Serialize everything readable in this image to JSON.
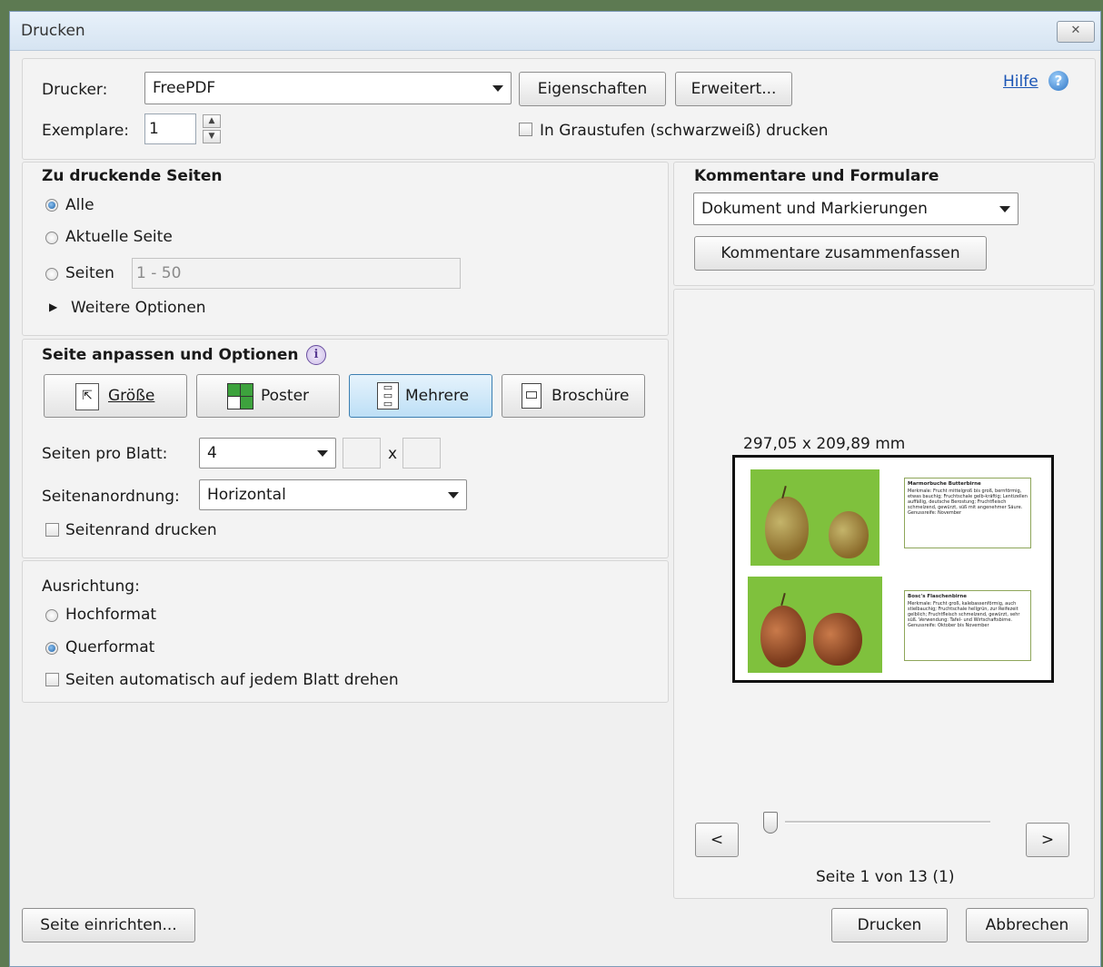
{
  "window": {
    "title": "Drucken",
    "close_label": "✕"
  },
  "header": {
    "printer_label": "Drucker:",
    "printer_value": "FreePDF",
    "properties_button": "Eigenschaften",
    "advanced_button": "Erweitert...",
    "help_link": "Hilfe",
    "copies_label": "Exemplare:",
    "copies_value": "1",
    "grayscale_label": "In Graustufen (schwarzweiß) drucken",
    "grayscale_checked": false
  },
  "pages": {
    "title": "Zu druckende Seiten",
    "all_label": "Alle",
    "current_label": "Aktuelle Seite",
    "pages_label": "Seiten",
    "pages_range": "1 - 50",
    "more_options": "Weitere Optionen",
    "selected": "Alle"
  },
  "sizing": {
    "title": "Seite anpassen und Optionen",
    "tabs": [
      {
        "label": "Größe",
        "active": false
      },
      {
        "label": "Poster",
        "active": false
      },
      {
        "label": "Mehrere",
        "active": true
      },
      {
        "label": "Broschüre",
        "active": false
      }
    ],
    "pages_per_sheet_label": "Seiten pro Blatt:",
    "pages_per_sheet_value": "4",
    "x_label": "x",
    "order_label": "Seitenanordnung:",
    "order_value": "Horizontal",
    "border_label": "Seitenrand drucken",
    "border_checked": false
  },
  "orientation": {
    "title": "Ausrichtung:",
    "portrait_label": "Hochformat",
    "landscape_label": "Querformat",
    "selected": "Querformat",
    "auto_rotate_label": "Seiten automatisch auf jedem Blatt drehen",
    "auto_rotate_checked": false
  },
  "comments": {
    "title": "Kommentare und Formulare",
    "select_value": "Dokument und Markierungen",
    "summarize_button": "Kommentare zusammenfassen"
  },
  "preview": {
    "dimensions": "297,05 x 209,89 mm",
    "prev_button": "<",
    "next_button": ">",
    "page_status": "Seite 1 von 13 (1)",
    "slider_position": 0
  },
  "footer": {
    "page_setup_button": "Seite einrichten...",
    "print_button": "Drucken",
    "cancel_button": "Abbrechen"
  },
  "colors": {
    "accent": "#3c7fb1",
    "help_link": "#1a55b5"
  }
}
